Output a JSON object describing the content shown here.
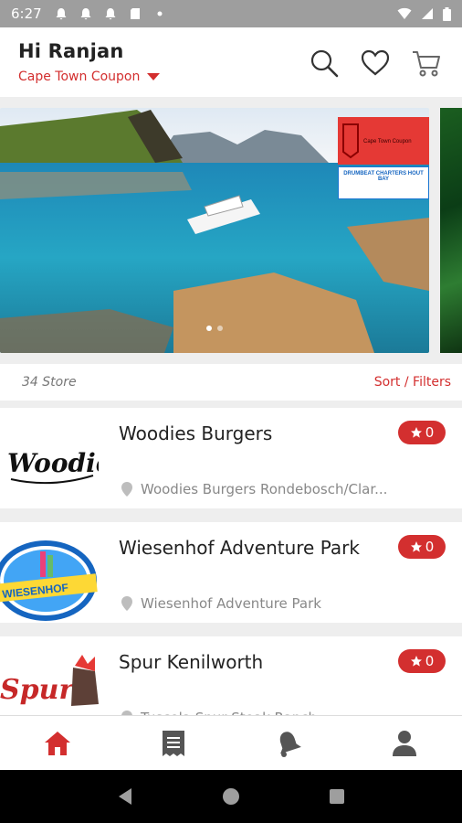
{
  "status_bar": {
    "time": "6:27"
  },
  "header": {
    "greeting": "Hi Ranjan",
    "city": "Cape Town Coupon"
  },
  "banner": {
    "logo_text": "Cape Town Coupon",
    "charter_text": "DRUMBEAT CHARTERS HOUT BAY"
  },
  "list": {
    "count_label": "34 Store",
    "sort_label": "Sort / Filters"
  },
  "stores": [
    {
      "name": "Woodies Burgers",
      "rating": "0",
      "location": "Woodies Burgers Rondebosch/Clar...",
      "logo_text": "Woodies"
    },
    {
      "name": "Wiesenhof Adventure Park",
      "rating": "0",
      "location": "Wiesenhof Adventure Park",
      "logo_text": "WIESENHOF"
    },
    {
      "name": "Spur Kenilworth",
      "rating": "0",
      "location": "Tuscola Spur Steak Ranch",
      "logo_text": "Spur"
    }
  ],
  "colors": {
    "accent": "#d32f2f",
    "statusbar": "#9e9e9e"
  },
  "icons": [
    "search-icon",
    "heart-icon",
    "cart-icon",
    "home-icon",
    "receipt-icon",
    "bell-icon",
    "user-icon",
    "location-pin-icon",
    "star-icon"
  ]
}
